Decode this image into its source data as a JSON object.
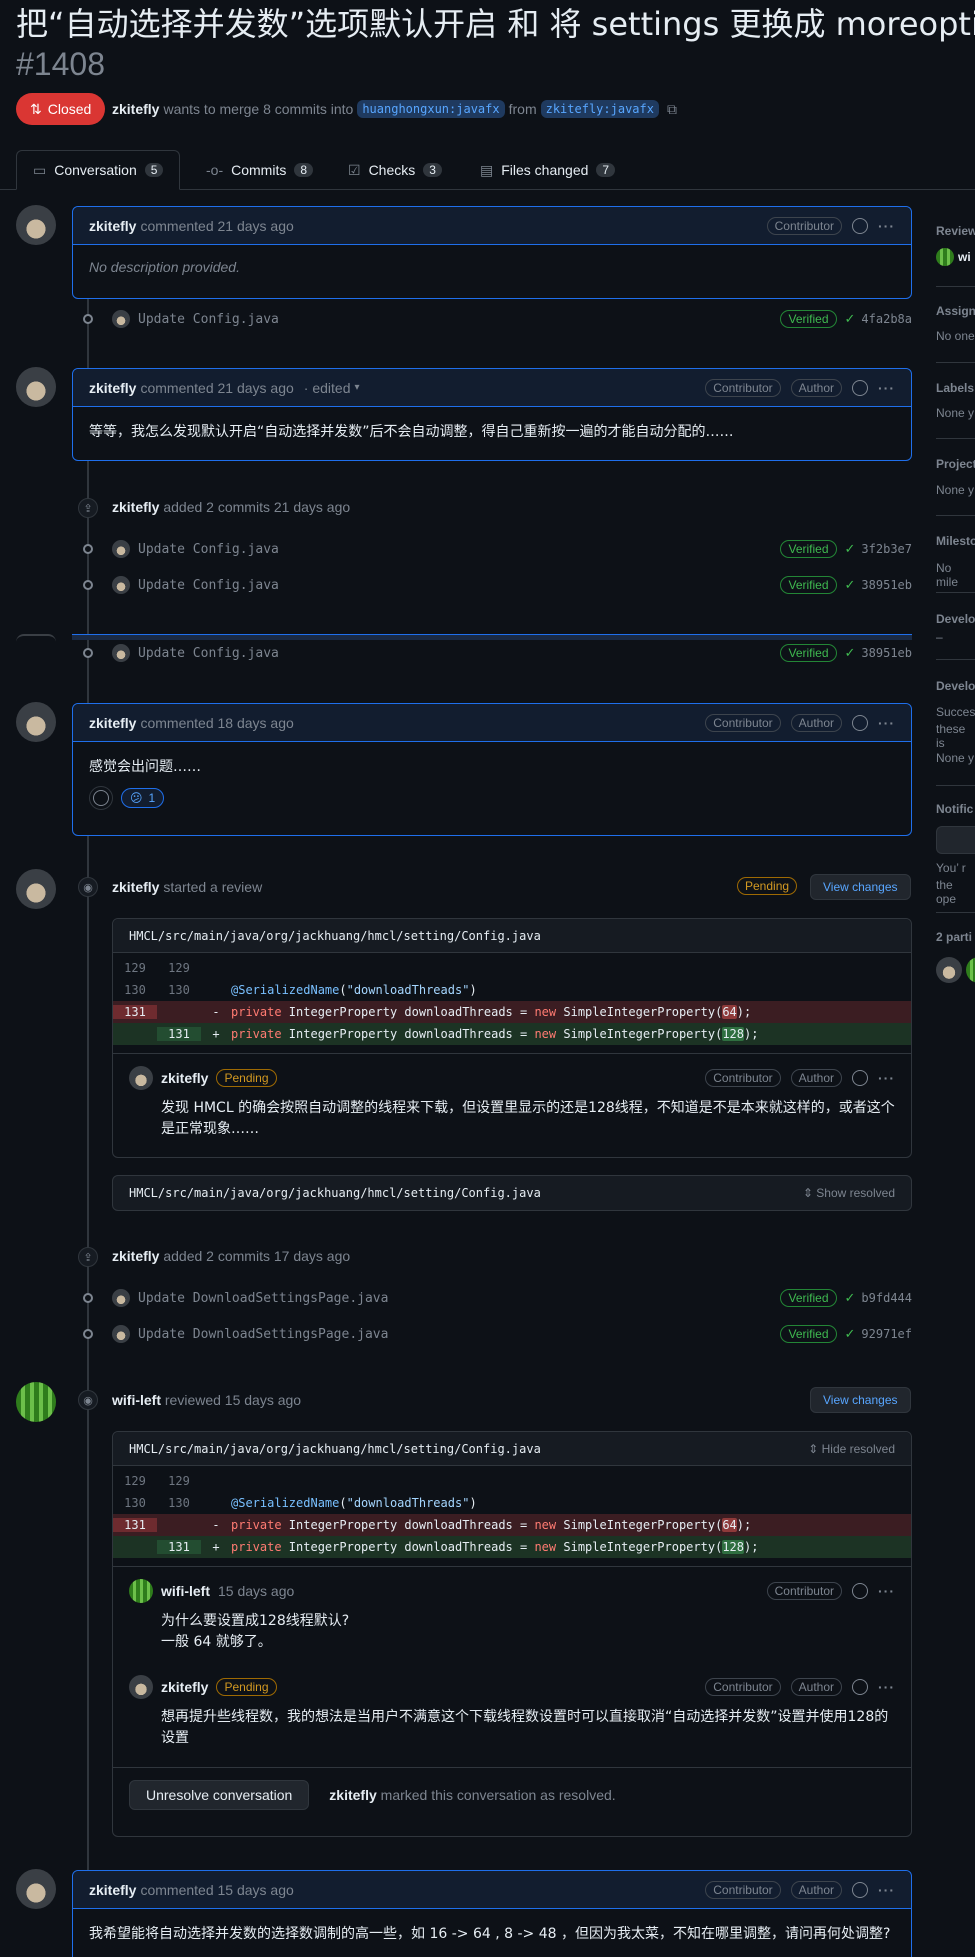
{
  "pr": {
    "title": "把“自动选择并发数”选项默认开启 和 将 settings 更换成 moreopti",
    "number": "#1408",
    "state": "Closed",
    "author": "zkitefly",
    "merge_text": "wants to merge 8 commits into",
    "base_branch": "huanghongxun:javafx",
    "from_text": "from",
    "head_branch": "zkitefly:javafx"
  },
  "tabs": [
    {
      "label": "Conversation",
      "count": "5"
    },
    {
      "label": "Commits",
      "count": "8"
    },
    {
      "label": "Checks",
      "count": "3"
    },
    {
      "label": "Files changed",
      "count": "7"
    }
  ],
  "comment1": {
    "author": "zkitefly",
    "action": "commented 21 days ago",
    "badge": "Contributor",
    "body": "No description provided."
  },
  "commit_a": {
    "message": "Update Config.java",
    "verified": "Verified",
    "sha": "4fa2b8a"
  },
  "comment2": {
    "author": "zkitefly",
    "action": "commented 21 days ago",
    "edited": "· edited",
    "badge1": "Contributor",
    "badge2": "Author",
    "body": "等等，我怎么发现默认开启“自动选择并发数”后不会自动调整，得自己重新按一遍的才能自动分配的……"
  },
  "event1": {
    "author": "zkitefly",
    "action": "added 2 commits 21 days ago"
  },
  "commit_b": {
    "message": "Update Config.java",
    "verified": "Verified",
    "sha": "3f2b3e7"
  },
  "commit_c": {
    "message": "Update Config.java",
    "verified": "Verified",
    "sha": "38951eb"
  },
  "commit_d": {
    "message": "Update Config.java",
    "verified": "Verified",
    "sha": "38951eb"
  },
  "comment3": {
    "author": "zkitefly",
    "action": "commented 18 days ago",
    "badge1": "Contributor",
    "badge2": "Author",
    "body": "感觉会出问题……",
    "reaction_emoji": "😕",
    "reaction_count": "1"
  },
  "review1": {
    "author": "zkitefly",
    "action": "started a review",
    "status": "Pending",
    "button": "View changes",
    "file": "HMCL/src/main/java/org/jackhuang/hmcl/setting/Config.java",
    "comment_author": "zkitefly",
    "comment_status": "Pending",
    "badge1": "Contributor",
    "badge2": "Author",
    "comment_body": "发现 HMCL 的确会按照自动调整的线程来下载，但设置里显示的还是128线程，不知道是不是本来就这样的，或者这个是正常现象……"
  },
  "resolved_file": {
    "file": "HMCL/src/main/java/org/jackhuang/hmcl/setting/Config.java",
    "action": "Show resolved"
  },
  "event2": {
    "author": "zkitefly",
    "action": "added 2 commits 17 days ago"
  },
  "commit_e": {
    "message": "Update DownloadSettingsPage.java",
    "verified": "Verified",
    "sha": "b9fd444"
  },
  "commit_f": {
    "message": "Update DownloadSettingsPage.java",
    "verified": "Verified",
    "sha": "92971ef"
  },
  "review2": {
    "author": "wifi-left",
    "action": "reviewed 15 days ago",
    "button": "View changes",
    "file": "HMCL/src/main/java/org/jackhuang/hmcl/setting/Config.java",
    "file_action": "Hide resolved",
    "c1_author": "wifi-left",
    "c1_time": "15 days ago",
    "c1_badge": "Contributor",
    "c1_line1": "为什么要设置成128线程默认?",
    "c1_line2": "一般 64 就够了。",
    "c2_author": "zkitefly",
    "c2_status": "Pending",
    "c2_badge1": "Contributor",
    "c2_badge2": "Author",
    "c2_body": "想再提升些线程数，我的想法是当用户不满意这个下载线程数设置时可以直接取消“自动选择并发数”设置并使用128的设置",
    "unresolve_button": "Unresolve conversation",
    "resolved_by": "zkitefly",
    "resolved_text": "marked this conversation as resolved."
  },
  "diff": {
    "l1": {
      "n1": "129",
      "n2": "129",
      "sign": "",
      "code": ""
    },
    "l2": {
      "n1": "130",
      "n2": "130",
      "sign": "",
      "annotation": "@SerializedName",
      "paren_open": "(",
      "string": "\"downloadThreads\"",
      "paren_close": ")"
    },
    "l3": {
      "n1": "131",
      "n2": "",
      "sign": "-",
      "kw1": "private",
      "type": " IntegerProperty downloadThreads = ",
      "kw2": "new",
      "ctor": " SimpleIntegerProperty(",
      "value": "64",
      "end": ");"
    },
    "l4": {
      "n1": "",
      "n2": "131",
      "sign": "+",
      "kw1": "private",
      "type": " IntegerProperty downloadThreads = ",
      "kw2": "new",
      "ctor": " SimpleIntegerProperty(",
      "value": "128",
      "end": ");"
    }
  },
  "comment4": {
    "author": "zkitefly",
    "action": "commented 15 days ago",
    "badge1": "Contributor",
    "badge2": "Author",
    "body": "我希望能将自动选择并发数的选择数调制的高一些，如 16 -> 64 , 8 -> 48 ，但因为我太菜，不知在哪里调整，请问再何处调整?"
  },
  "sidebar": {
    "reviewers": "Review",
    "reviewer_name": "wi",
    "assignees": "Assign",
    "assignees_value": "No one",
    "labels": "Labels",
    "labels_value": "None y",
    "projects": "Project",
    "projects_value": "None y",
    "milestone": "Milesto",
    "milestone_value": "No mile",
    "development": "Develo",
    "development_value": "–",
    "development2": "Develo",
    "development2_value1": "Succes",
    "development2_value2": "these is",
    "development2_value3": "None y",
    "notifications": "Notific",
    "notif_text1": "You’ r",
    "notif_text2": "the ope",
    "participants": "2 parti"
  }
}
